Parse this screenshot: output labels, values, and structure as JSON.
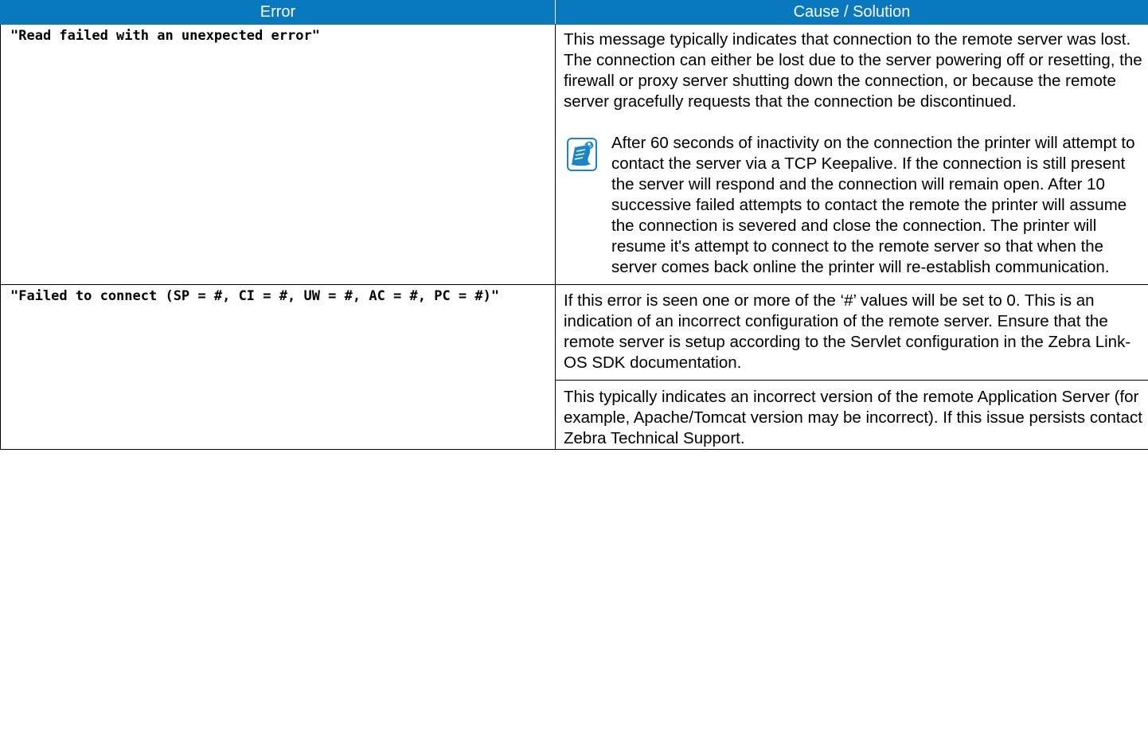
{
  "table": {
    "header": {
      "error": "Error",
      "cause": "Cause / Solution"
    },
    "rows": [
      {
        "error": "\"Read failed with an unexpected error\"",
        "cause_paragraph": "This message typically indicates that connection to the remote server was lost. The connection can either be lost due to the server powering off or resetting, the firewall or proxy server shutting down the connection, or because the remote server gracefully requests that the connection be discontinued.",
        "note_icon": "note-icon",
        "note": "After 60 seconds of inactivity on the connection the printer will attempt to contact the server via a TCP Keepalive. If the connection is still present the server will respond and the connection will remain open. After 10 successive failed attempts to contact the remote the printer will assume the connection is severed and close the connection. The printer will resume it's attempt to connect to the remote server so that when the server comes back online the printer will re-establish communication."
      },
      {
        "error": "\"Failed to connect (SP = #, CI = #, UW = #, AC = #, PC = #)\"",
        "cause_paragraph_1": "If this error is seen one or more of the ‘#’ values will be set to 0. This is an indication of an incorrect configuration of the remote server. Ensure that the remote server is setup according to the Servlet configuration in the Zebra Link-OS SDK documentation.",
        "cause_paragraph_2": "This typically indicates an incorrect version of the remote Application Server (for example, Apache/Tomcat version may be incorrect). If this issue persists contact Zebra Technical Support."
      }
    ]
  },
  "colors": {
    "header_bg": "#0a78bf",
    "header_text": "#ffffff",
    "icon_blue": "#1a86c8"
  }
}
